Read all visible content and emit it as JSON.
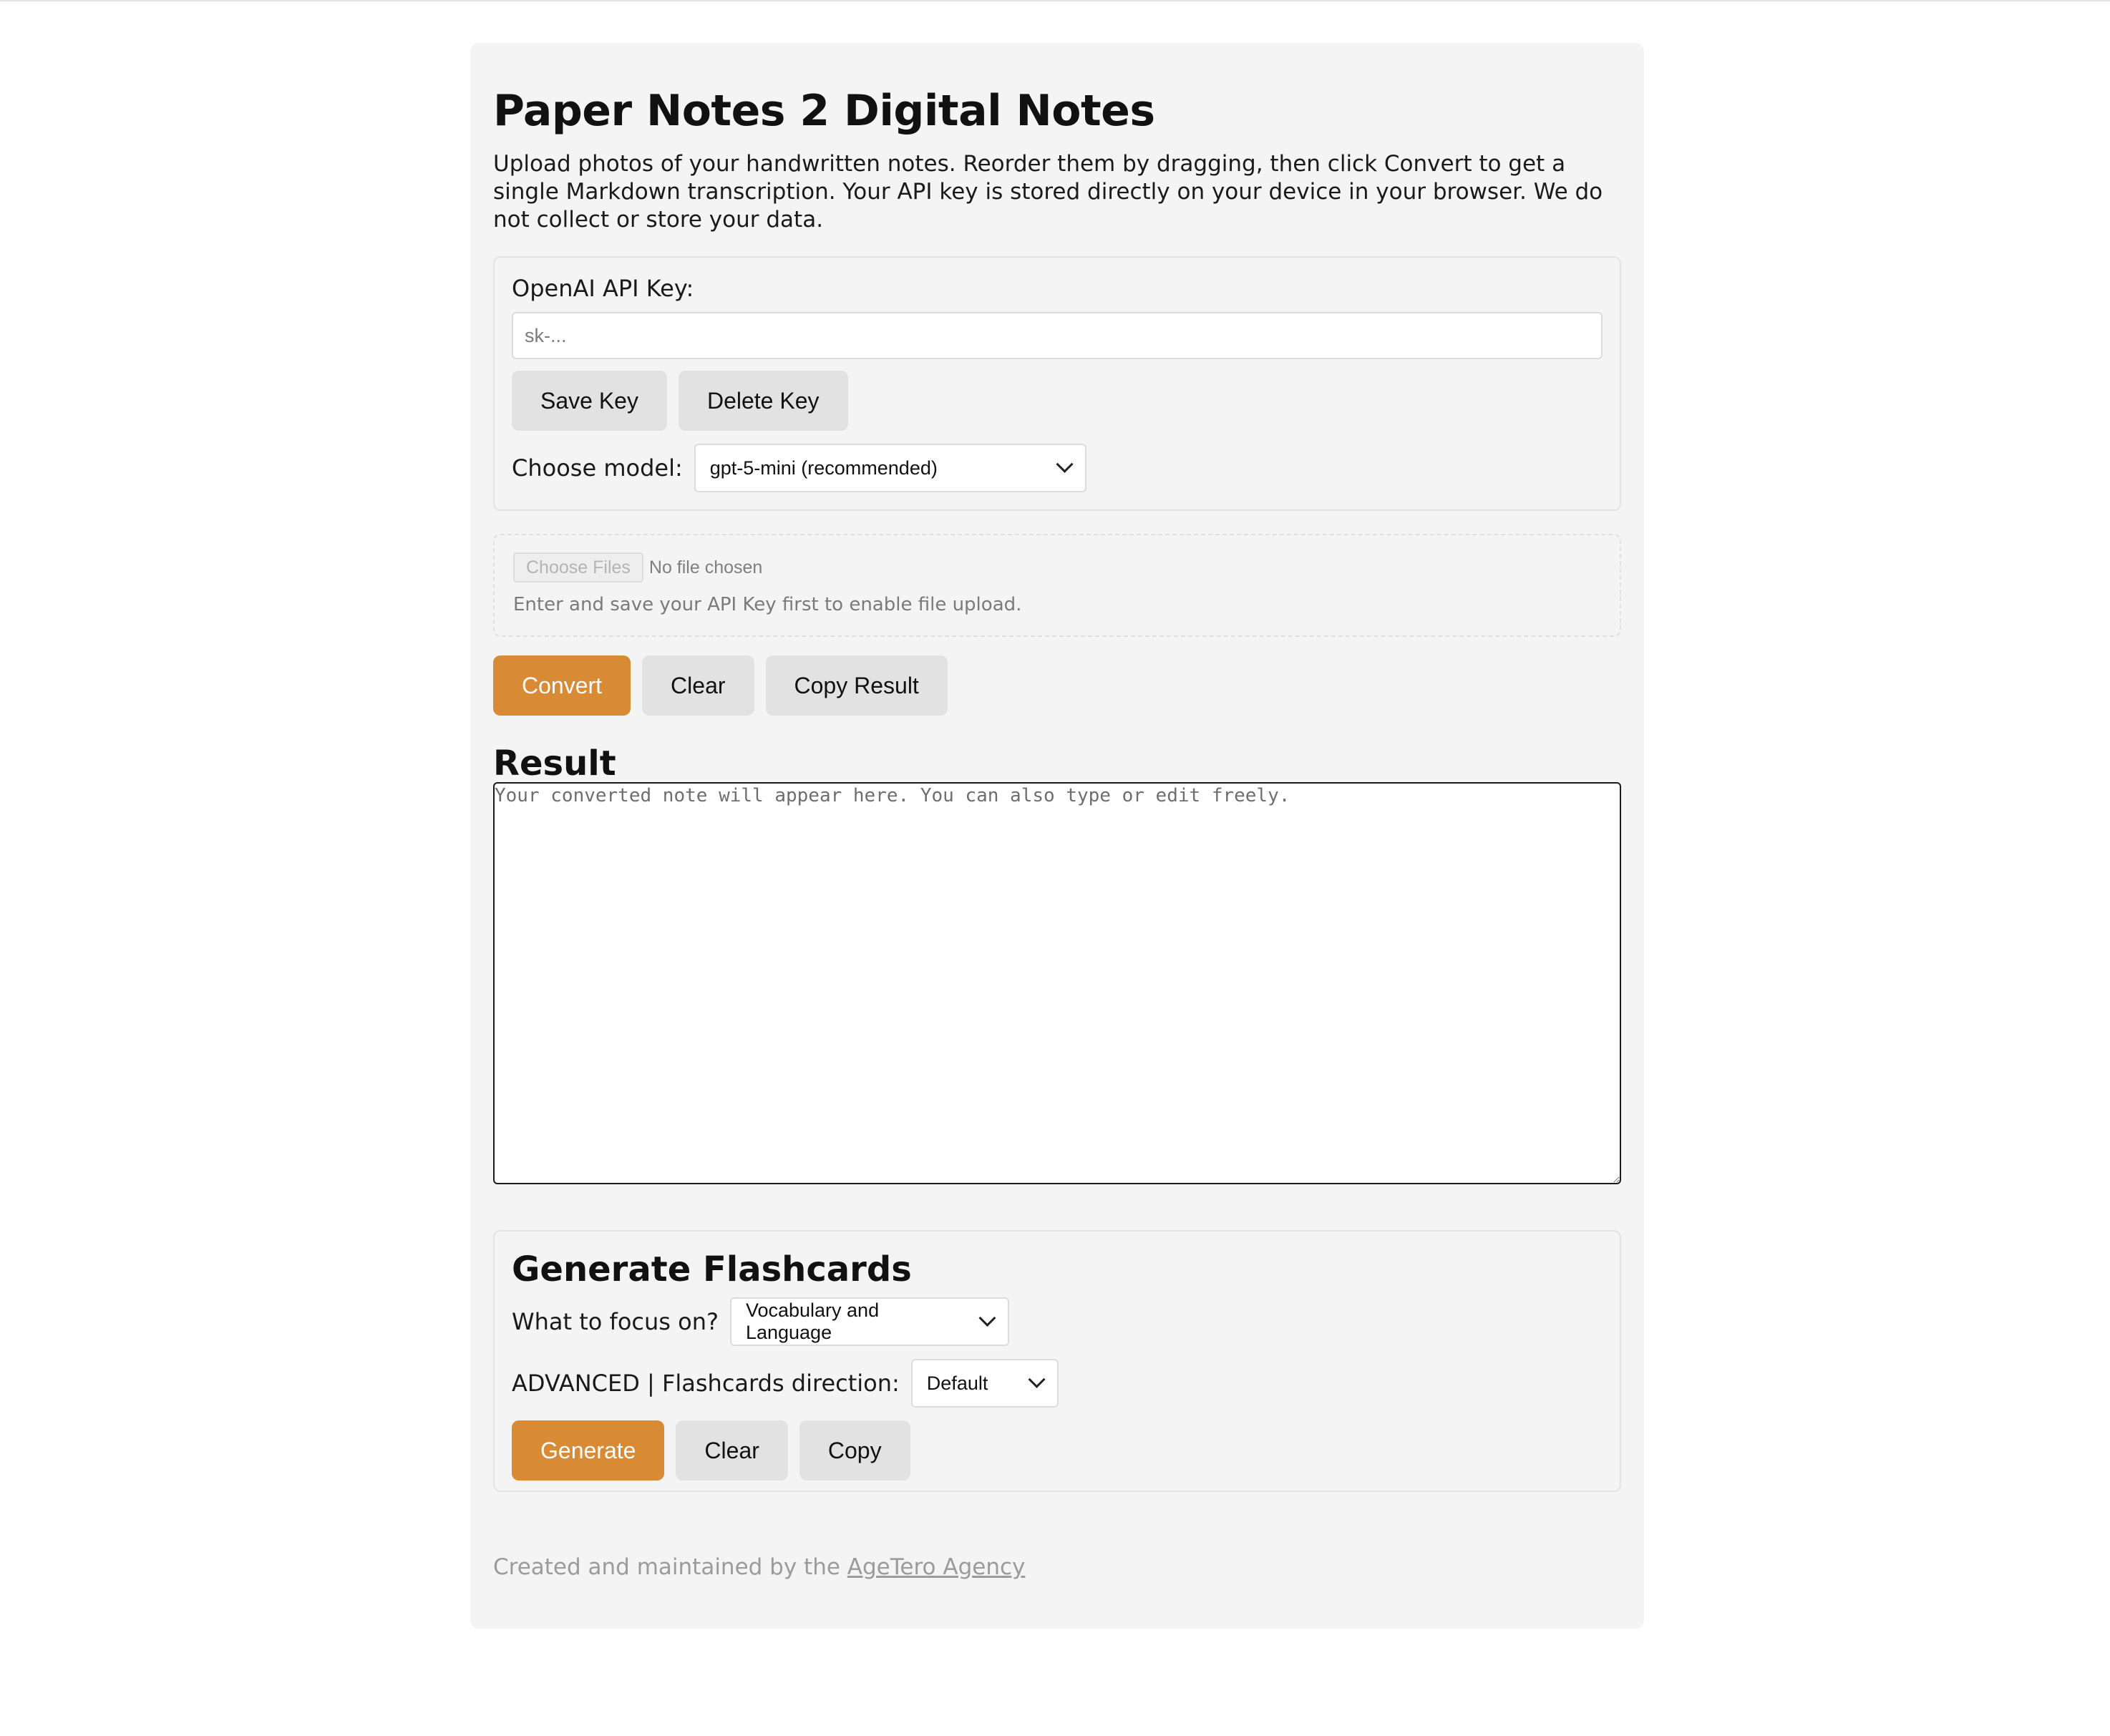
{
  "page": {
    "title": "Paper Notes 2 Digital Notes",
    "intro": "Upload photos of your handwritten notes. Reorder them by dragging, then click Convert to get a single Markdown transcription. Your API key is stored directly on your device in your browser. We do not collect or store your data."
  },
  "api_key": {
    "label": "OpenAI API Key:",
    "placeholder": "sk-...",
    "value": "",
    "save_label": "Save Key",
    "delete_label": "Delete Key",
    "model_label": "Choose model:",
    "model_selected": "gpt-5-mini (recommended)"
  },
  "upload": {
    "choose_label": "Choose Files",
    "status": "No file chosen",
    "hint": "Enter and save your API Key first to enable file upload."
  },
  "actions": {
    "convert_label": "Convert",
    "clear_label": "Clear",
    "copy_label": "Copy Result"
  },
  "result": {
    "heading": "Result",
    "placeholder": "Your converted note will appear here. You can also type or edit freely.",
    "value": ""
  },
  "flashcards": {
    "heading": "Generate Flashcards",
    "focus_label": "What to focus on?",
    "focus_selected": "Vocabulary and Language",
    "direction_label": "ADVANCED | Flashcards direction:",
    "direction_selected": "Default",
    "generate_label": "Generate",
    "clear_label": "Clear",
    "copy_label": "Copy"
  },
  "footer": {
    "prefix": "Created and maintained by the ",
    "link_text": "AgeTero Agency"
  },
  "colors": {
    "accent": "#d88a35",
    "panel_bg": "#f4f4f4",
    "button_bg": "#e2e2e2"
  }
}
